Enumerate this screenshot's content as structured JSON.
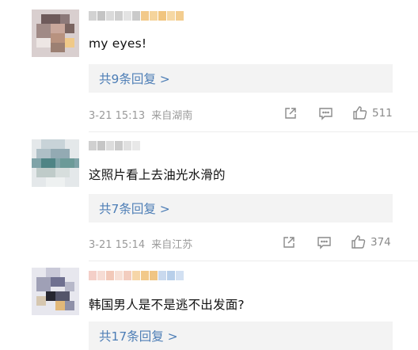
{
  "comments": [
    {
      "text": "my eyes!",
      "replies_label": "共9条回复 >",
      "time": "3-21 15:13",
      "location": "来自湖南",
      "likes": "511"
    },
    {
      "text": "这照片看上去油光水滑的",
      "replies_label": "共7条回复 >",
      "time": "3-21 15:14",
      "location": "来自江苏",
      "likes": "374"
    },
    {
      "text": "韩国男人是不是逃不出发面?",
      "replies_label": "共17条回复 >"
    }
  ],
  "icons": {
    "share": "share-icon",
    "comment": "comment-icon",
    "like": "thumbs-up-icon"
  },
  "colors": {
    "link": "#4d7eb6",
    "meta": "#9a9a9a",
    "reply_bg": "#f3f3f3"
  }
}
